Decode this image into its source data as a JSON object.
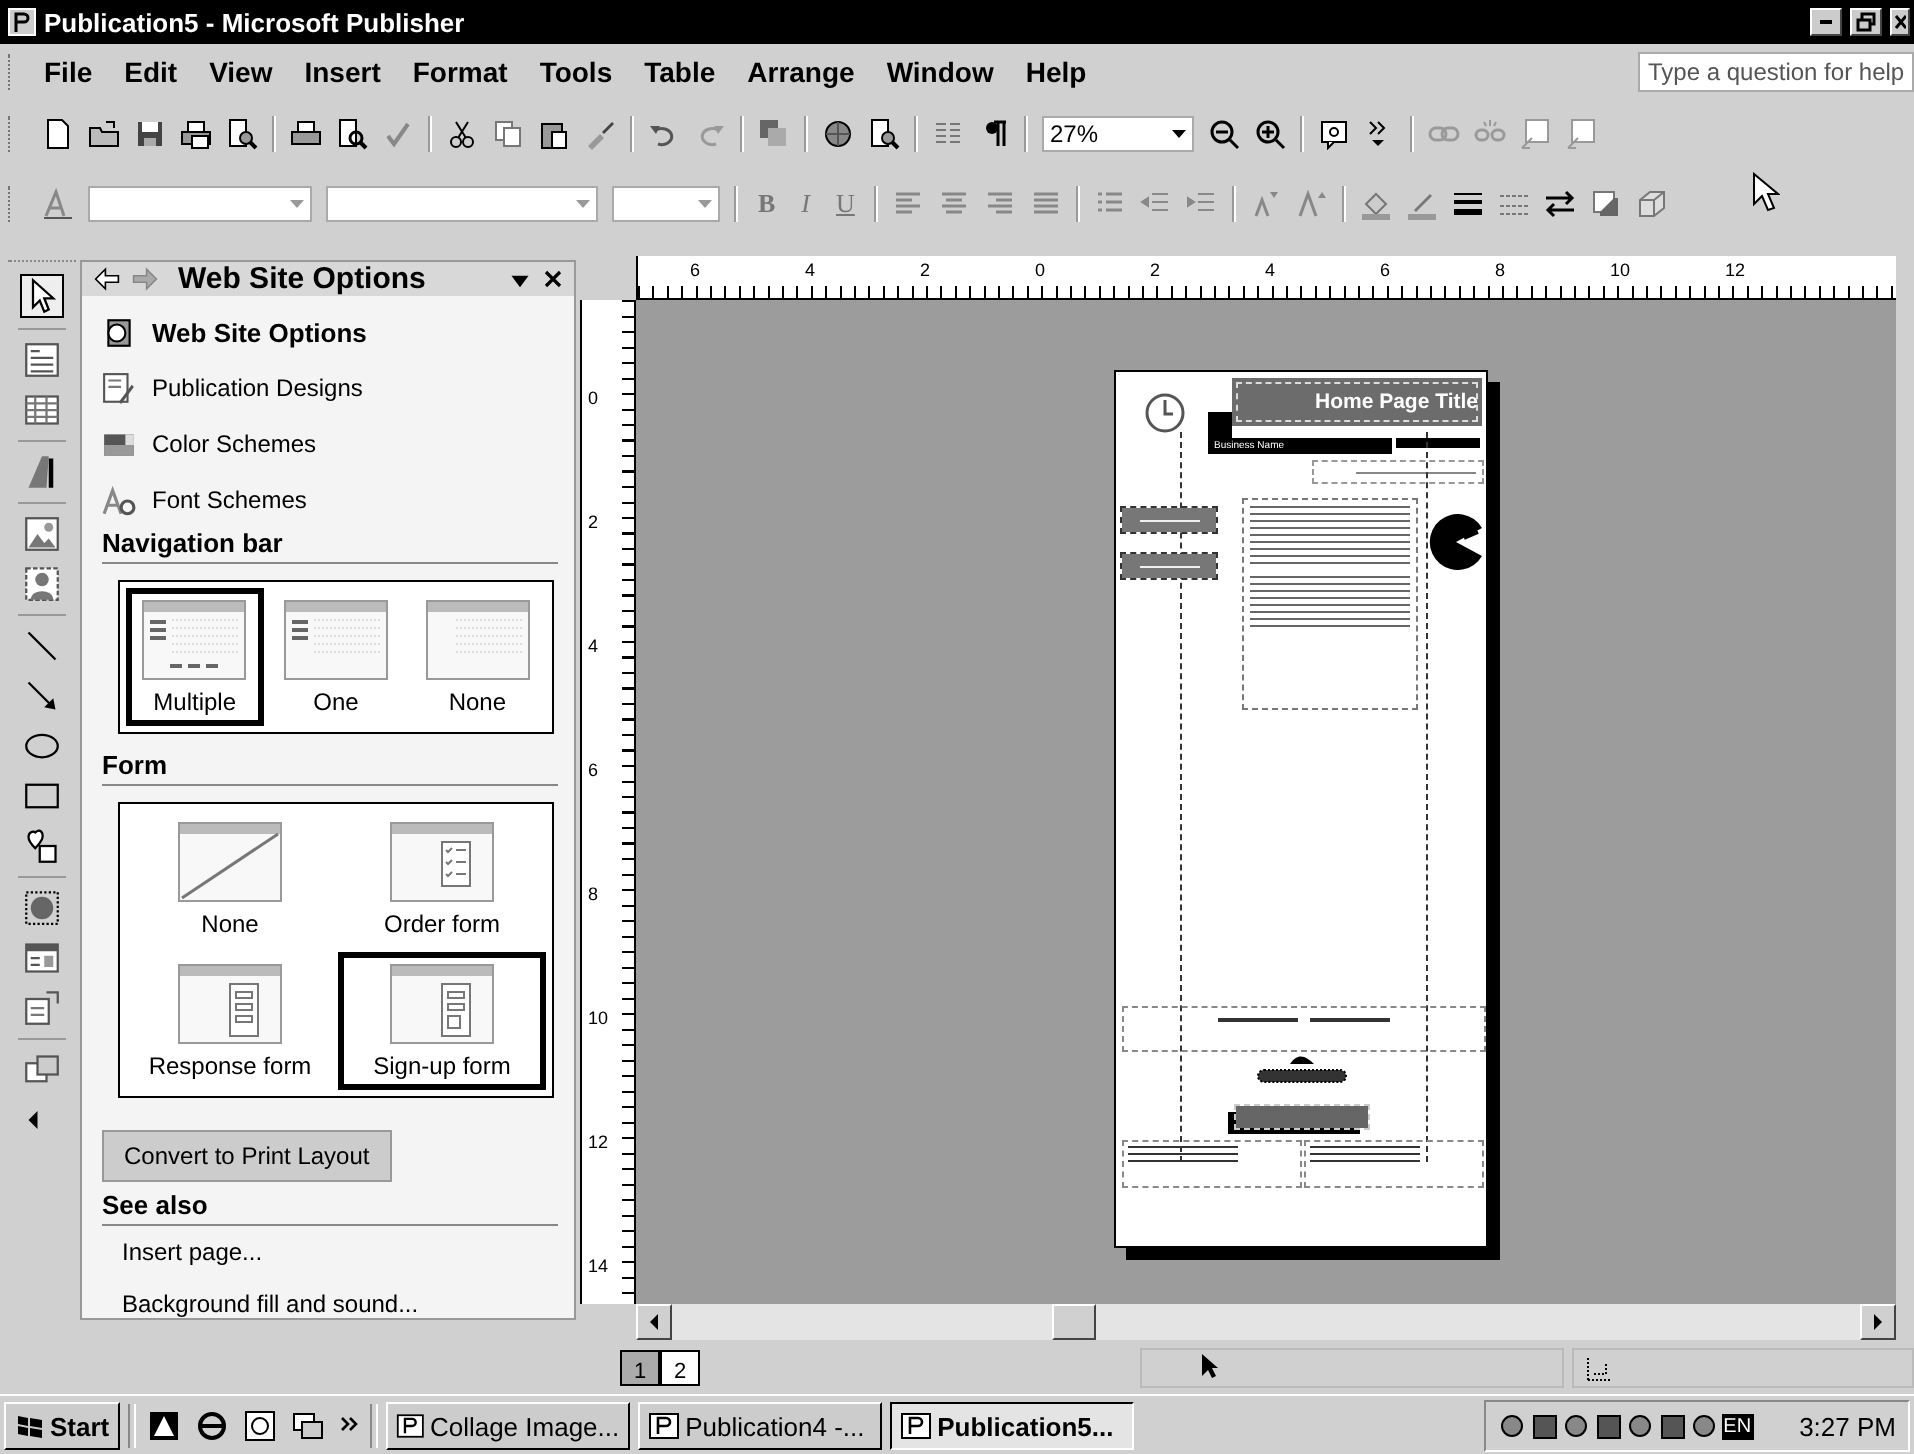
{
  "window": {
    "title": "Publication5 - Microsoft Publisher"
  },
  "menu": [
    "File",
    "Edit",
    "View",
    "Insert",
    "Format",
    "Tools",
    "Table",
    "Arrange",
    "Window",
    "Help"
  ],
  "help_box": {
    "placeholder": "Type a question for help"
  },
  "zoom_box": {
    "value": "27%"
  },
  "format_buttons": [
    "B",
    "I",
    "U"
  ],
  "task_pane": {
    "title": "Web Site Options",
    "items": [
      {
        "label": "Web Site Options",
        "kind": "web",
        "selected": true
      },
      {
        "label": "Publication Designs",
        "kind": "designs",
        "selected": false
      },
      {
        "label": "Color Schemes",
        "kind": "colors",
        "selected": false
      },
      {
        "label": "Font Schemes",
        "kind": "fonts",
        "selected": false
      }
    ],
    "navigation_bar": {
      "heading": "Navigation bar",
      "options": [
        {
          "label": "Multiple",
          "kind": "multiple",
          "selected": true
        },
        {
          "label": "One",
          "kind": "one",
          "selected": false
        },
        {
          "label": "None",
          "kind": "none",
          "selected": false
        }
      ]
    },
    "form": {
      "heading": "Form",
      "options": [
        {
          "label": "None",
          "kind": "none",
          "selected": false
        },
        {
          "label": "Order form",
          "kind": "order",
          "selected": false
        },
        {
          "label": "Response form",
          "kind": "response",
          "selected": false
        },
        {
          "label": "Sign-up form",
          "kind": "signup",
          "selected": true
        }
      ]
    },
    "button": "Convert to Print Layout",
    "see_also": {
      "heading": "See also",
      "links": [
        "Insert page...",
        "Background fill and sound..."
      ]
    }
  },
  "rulers": {
    "horizontal": [
      "6",
      "4",
      "2",
      "0",
      "2",
      "4",
      "6",
      "8",
      "10",
      "12"
    ],
    "vertical": [
      "0",
      "2",
      "4",
      "6",
      "8",
      "10",
      "12",
      "14"
    ]
  },
  "publication": {
    "title": "Home Page Title",
    "business_name": "Business Name"
  },
  "page_tabs": [
    {
      "label": "1",
      "selected": true
    },
    {
      "label": "2",
      "selected": false
    }
  ],
  "taskbar": {
    "start": "Start",
    "tasks": [
      {
        "label": "Collage Image...",
        "selected": false
      },
      {
        "label": "Publication4 -...",
        "selected": false
      },
      {
        "label": "Publication5...",
        "selected": true
      }
    ],
    "language": "EN",
    "clock": "3:27 PM"
  }
}
